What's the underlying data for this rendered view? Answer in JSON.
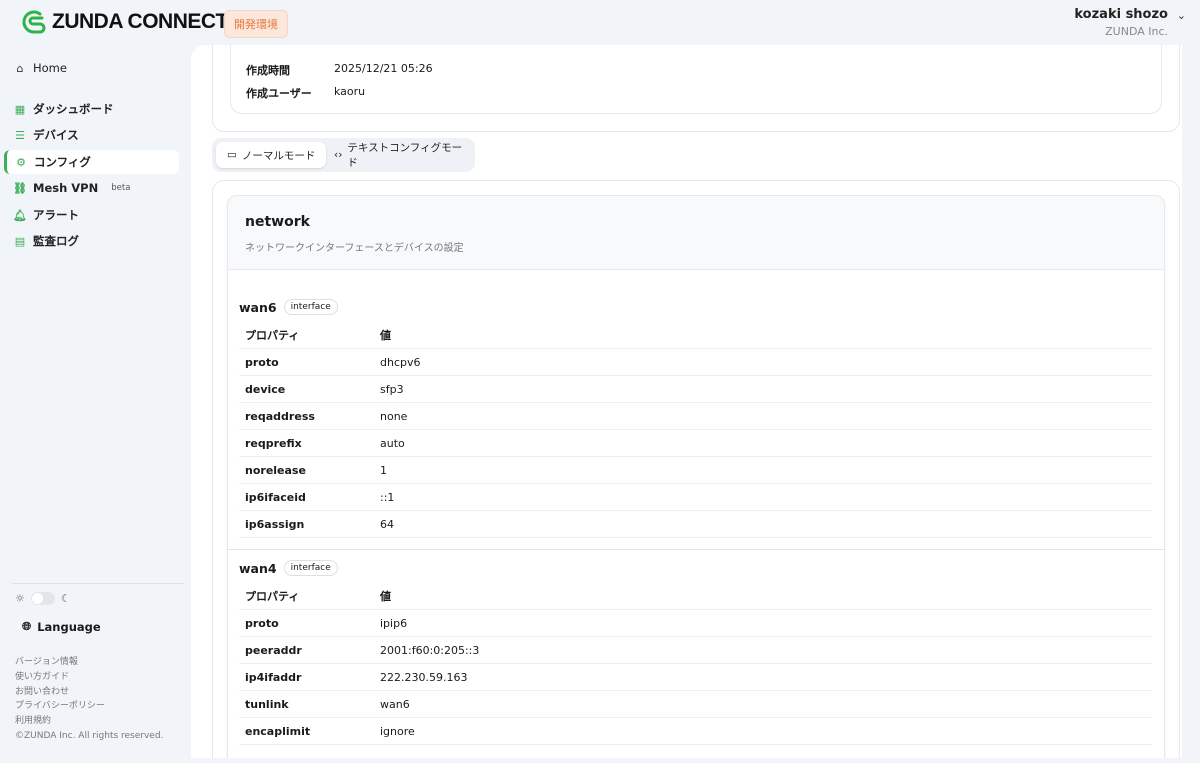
{
  "header": {
    "brand": "ZUNDA CONNECT",
    "env_badge": "開発環境",
    "user_name": "kozaki shozo",
    "org": "ZUNDA Inc."
  },
  "sidebar": {
    "home": "Home",
    "items": [
      {
        "label": "ダッシュボード",
        "icon": "dashboard-icon"
      },
      {
        "label": "デバイス",
        "icon": "server-icon"
      },
      {
        "label": "コンフィグ",
        "icon": "gear-icon"
      },
      {
        "label": "Mesh VPN",
        "icon": "network-icon",
        "badge": "beta"
      },
      {
        "label": "アラート",
        "icon": "bell-icon"
      },
      {
        "label": "監査ログ",
        "icon": "clipboard-icon"
      }
    ],
    "language": "Language",
    "links": [
      "バージョン情報",
      "使い方ガイド",
      "お問い合わせ",
      "プライバシーポリシー",
      "利用規約"
    ],
    "copyright": "©ZUNDA Inc. All rights reserved."
  },
  "meta": {
    "created_at_label": "作成時間",
    "created_at": "2025/12/21 05:26",
    "created_by_label": "作成ユーザー",
    "created_by": "kaoru"
  },
  "modes": {
    "normal": "ノーマルモード",
    "text": "テキストコンフィグモード"
  },
  "section": {
    "title": "network",
    "description": "ネットワークインターフェースとデバイスの設定",
    "col_property": "プロパティ",
    "col_value": "値",
    "interfaces": [
      {
        "name": "wan6",
        "type": "interface",
        "rows": [
          [
            "proto",
            "dhcpv6"
          ],
          [
            "device",
            "sfp3"
          ],
          [
            "reqaddress",
            "none"
          ],
          [
            "reqprefix",
            "auto"
          ],
          [
            "norelease",
            "1"
          ],
          [
            "ip6ifaceid",
            "::1"
          ],
          [
            "ip6assign",
            "64"
          ]
        ]
      },
      {
        "name": "wan4",
        "type": "interface",
        "rows": [
          [
            "proto",
            "ipip6"
          ],
          [
            "peeraddr",
            "2001:f60:0:205::3"
          ],
          [
            "ip4ifaddr",
            "222.230.59.163"
          ],
          [
            "tunlink",
            "wan6"
          ],
          [
            "encaplimit",
            "ignore"
          ]
        ]
      }
    ]
  }
}
